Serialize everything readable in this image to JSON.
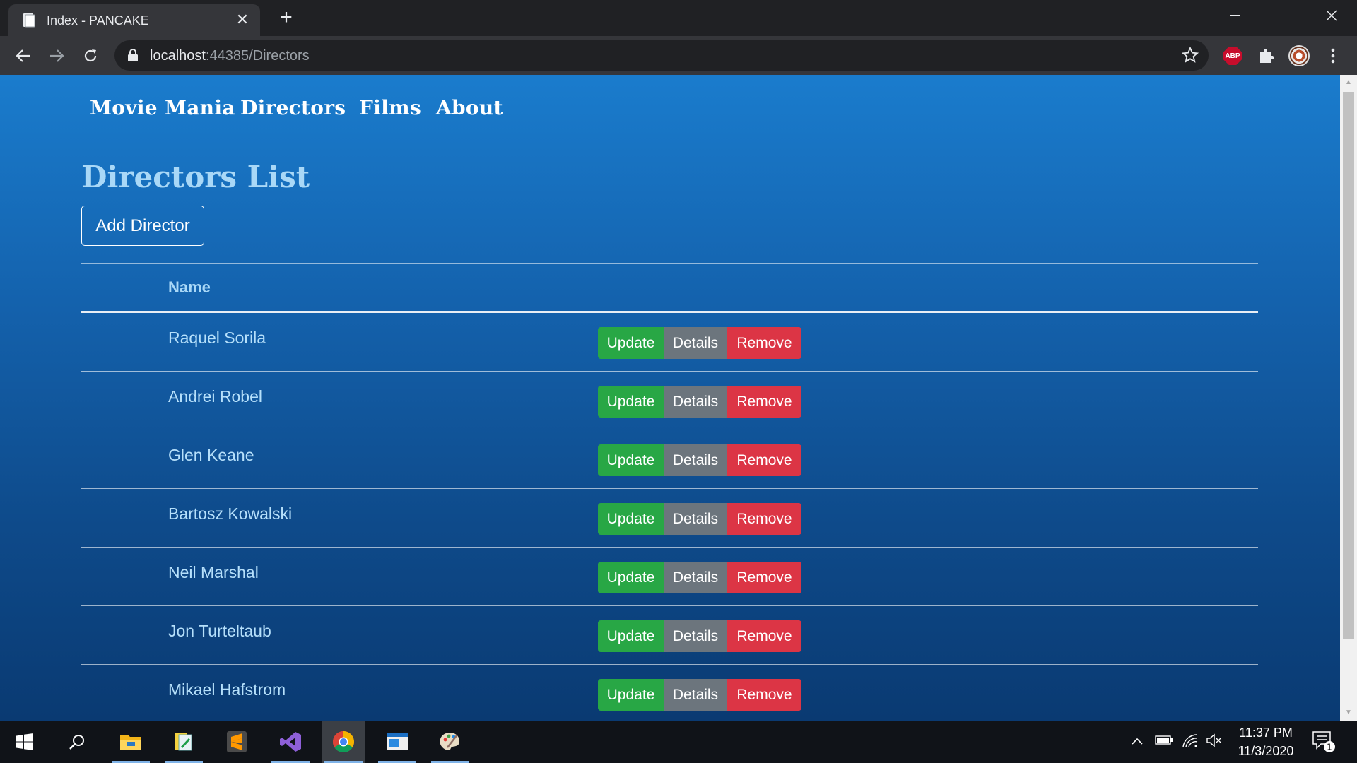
{
  "browser": {
    "tab_title": "Index - PANCAKE",
    "url_host": "localhost",
    "url_path": ":44385/Directors",
    "extension_abp_label": "ABP"
  },
  "site": {
    "nav": [
      "Movie Mania",
      "Directors",
      "Films",
      "About"
    ]
  },
  "page": {
    "title": "Directors List",
    "add_button": "Add Director",
    "column_name": "Name",
    "actions": {
      "update": "Update",
      "details": "Details",
      "remove": "Remove"
    },
    "directors": [
      "Raquel Sorila",
      "Andrei Robel",
      "Glen Keane",
      "Bartosz Kowalski",
      "Neil Marshal",
      "Jon Turteltaub",
      "Mikael Hafstrom"
    ]
  },
  "colors": {
    "update": "#28a745",
    "details": "#6c757d",
    "remove": "#dc3545",
    "background_top": "#1a7ccd",
    "background_bottom": "#0a3a72"
  },
  "taskbar": {
    "time": "11:37 PM",
    "date": "11/3/2020",
    "notification_count": "1"
  }
}
